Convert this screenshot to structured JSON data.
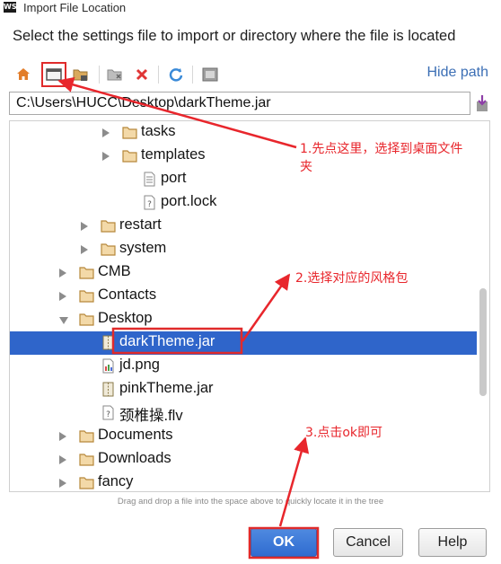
{
  "window": {
    "logo": "WS",
    "title": "Import File Location"
  },
  "dialog": {
    "subtitle": "Select the settings file to import or directory where the file is located",
    "hide_path": "Hide path",
    "path": "C:\\Users\\HUCC\\Desktop\\darkTheme.jar",
    "hint": "Drag and drop a file into the space above to quickly locate it in the tree"
  },
  "toolbar": {
    "icons": [
      "home-icon",
      "desktop-icon",
      "project-folder-icon",
      "new-folder-icon",
      "delete-icon",
      "refresh-icon",
      "show-hidden-icon"
    ]
  },
  "tree": {
    "items": [
      {
        "label": "tasks",
        "type": "folder",
        "expandable": true
      },
      {
        "label": "templates",
        "type": "folder",
        "expandable": true
      },
      {
        "label": "port",
        "type": "file"
      },
      {
        "label": "port.lock",
        "type": "file-unknown"
      },
      {
        "label": "restart",
        "type": "folder",
        "expandable": true
      },
      {
        "label": "system",
        "type": "folder",
        "expandable": true
      },
      {
        "label": "CMB",
        "type": "folder",
        "expandable": true
      },
      {
        "label": "Contacts",
        "type": "folder",
        "expandable": true
      },
      {
        "label": "Desktop",
        "type": "folder",
        "expanded": true
      },
      {
        "label": "darkTheme.jar",
        "type": "archive",
        "selected": true
      },
      {
        "label": "jd.png",
        "type": "image"
      },
      {
        "label": "pinkTheme.jar",
        "type": "archive"
      },
      {
        "label": "颈椎操.flv",
        "type": "file-unknown"
      },
      {
        "label": "Documents",
        "type": "folder",
        "expandable": true
      },
      {
        "label": "Downloads",
        "type": "folder",
        "expandable": true
      },
      {
        "label": "fancy",
        "type": "folder",
        "expandable": true
      }
    ]
  },
  "buttons": {
    "ok": "OK",
    "cancel": "Cancel",
    "help": "Help"
  },
  "annotations": {
    "step1_line1": "1.先点这里，选择到桌面文件",
    "step1_line2": "夹",
    "step2": "2.选择对应的风格包",
    "step3": "3.点击ok即可"
  },
  "colors": {
    "selection": "#2f65ca",
    "annotation_red": "#e8262c",
    "link_blue": "#3c6fb5",
    "ok_button": "#2f6bd0"
  }
}
